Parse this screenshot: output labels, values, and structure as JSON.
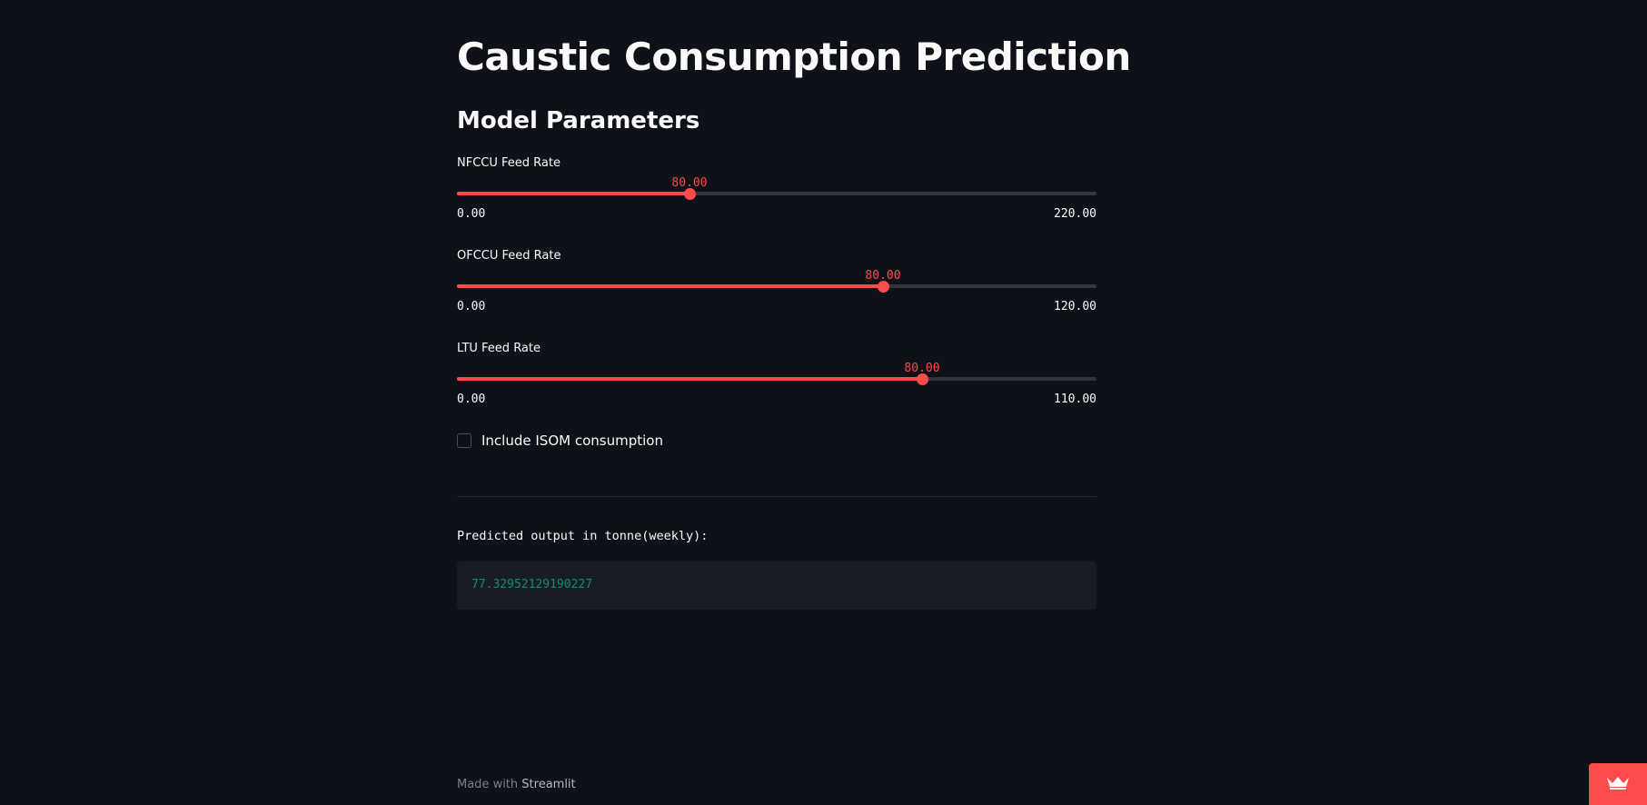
{
  "page": {
    "title": "Caustic Consumption Prediction",
    "subtitle": "Model Parameters"
  },
  "sliders": [
    {
      "label": "NFCCU Feed Rate",
      "value": "80.00",
      "min": "0.00",
      "max": "220.00",
      "fraction": 0.3636
    },
    {
      "label": "OFCCU Feed Rate",
      "value": "80.00",
      "min": "0.00",
      "max": "120.00",
      "fraction": 0.6667
    },
    {
      "label": "LTU Feed Rate",
      "value": "80.00",
      "min": "0.00",
      "max": "110.00",
      "fraction": 0.7273
    }
  ],
  "checkbox": {
    "label": "Include ISOM consumption",
    "checked": false
  },
  "prediction": {
    "label": "Predicted output in tonne(weekly):",
    "value": "77.32952129190227"
  },
  "footer": {
    "prefix": "Made with ",
    "brand": "Streamlit"
  },
  "colors": {
    "background": "#0e1117",
    "accent": "#ff4b4b",
    "code_text": "#0b8c6e"
  },
  "icons": {
    "deploy_badge": "crown-icon"
  }
}
